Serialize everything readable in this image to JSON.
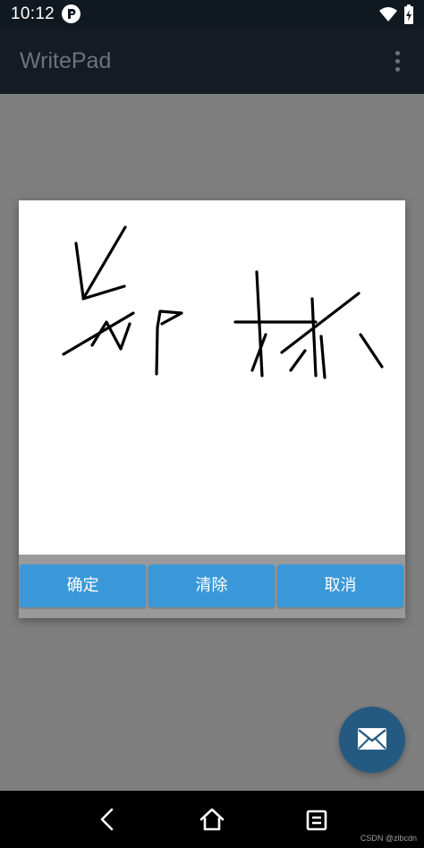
{
  "status_bar": {
    "time": "10:12",
    "app_icon": "pocket-p-icon",
    "wifi_icon": "wifi-icon",
    "battery_icon": "battery-charging-icon"
  },
  "app_bar": {
    "title": "WritePad",
    "menu_icon": "more-vertical-icon"
  },
  "dialog": {
    "canvas": "handwriting-canvas",
    "buttons": {
      "confirm": "确定",
      "clear": "清除",
      "cancel": "取消"
    }
  },
  "fab": {
    "icon": "mail-icon"
  },
  "nav_bar": {
    "back_icon": "back-icon",
    "home_icon": "home-icon",
    "recents_icon": "recents-icon"
  },
  "watermark": "CSDN @zlbcdn",
  "colors": {
    "status_bar": "#101820",
    "app_bar": "#141b22",
    "scrim": "#7f7f7f",
    "button": "#3b98d8",
    "fab": "#245a82"
  }
}
